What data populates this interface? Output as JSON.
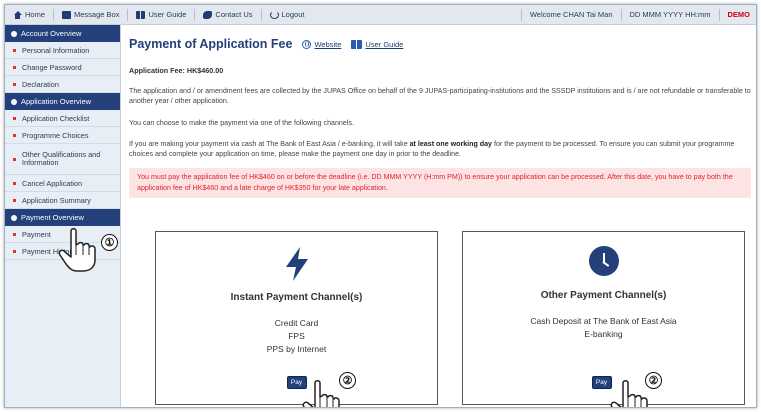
{
  "topbar": {
    "home": "Home",
    "message_box": "Message Box",
    "user_guide": "User Guide",
    "contact_us": "Contact Us",
    "logout": "Logout",
    "welcome": "Welcome CHAN Tai Man",
    "datetime": "DD MMM YYYY HH:mm",
    "demo": "DEMO"
  },
  "sidebar": {
    "sections": [
      {
        "heading": "Account Overview",
        "items": [
          "Personal Information",
          "Change Password",
          "Declaration"
        ]
      },
      {
        "heading": "Application Overview",
        "items": [
          "Application Checklist",
          "Programme Choices",
          "Other Qualifications and Information",
          "Cancel Application",
          "Application Summary"
        ]
      },
      {
        "heading": "Payment Overview",
        "items": [
          "Payment",
          "Payment History"
        ]
      }
    ]
  },
  "main": {
    "title": "Payment of Application Fee",
    "website_link": "Website",
    "user_guide_link": "User Guide",
    "fee_label": "Application Fee: HK$460.00",
    "para1": "The application and / or amendment fees are collected by the JUPAS Office on behalf of the 9 JUPAS-participating-institutions and the SSSDP institutions and is / are not refundable or transferable to another year / other application.",
    "para2": "You can choose to make the payment via one of the following channels.",
    "para3_a": "If you are making your payment via cash at The Bank of East Asia / e-banking, it will take ",
    "para3_b": "at least one working day",
    "para3_c": " for the payment to be processed. To ensure you can submit your programme choices and complete your application on time, please make the payment one day in prior to the deadline.",
    "warning": "You must pay the application fee of HK$460 on or before the deadline (i.e. DD MMM YYYY (H:mm PM)) to ensure your application can be processed. After this date, you have to pay both the application fee of HK$460 and a late charge of HK$350 for your late application."
  },
  "cards": [
    {
      "title": "Instant Payment Channel(s)",
      "options": [
        "Credit Card",
        "FPS",
        "PPS by Internet"
      ],
      "button": "Pay",
      "icon": "lightning-icon"
    },
    {
      "title": "Other Payment Channel(s)",
      "options": [
        "Cash Deposit at The Bank of East Asia",
        "E-banking"
      ],
      "button": "Pay",
      "icon": "clock-icon"
    }
  ],
  "annotations": {
    "step1": "①",
    "step2": "②"
  },
  "colors": {
    "navy": "#23407a",
    "warning_bg": "#fde3e3",
    "warning_text": "#e0242c",
    "demo": "#d0021b"
  }
}
